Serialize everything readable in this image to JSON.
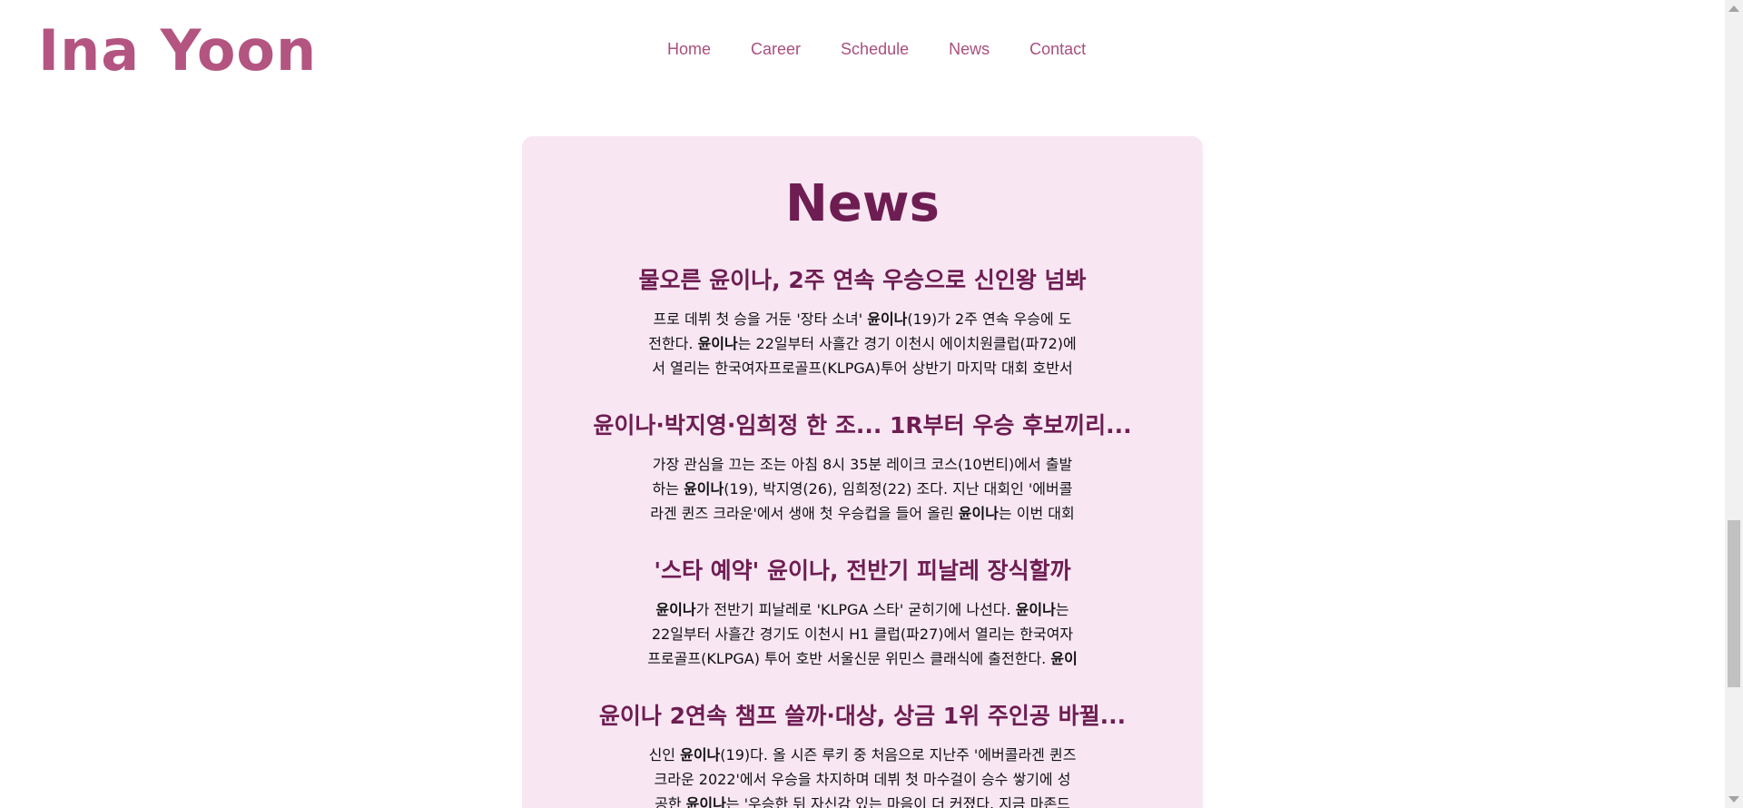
{
  "header": {
    "logo": "Ina Yoon",
    "nav": [
      "Home",
      "Career",
      "Schedule",
      "News",
      "Contact"
    ]
  },
  "news": {
    "title": "News",
    "articles": [
      {
        "title": "물오른 윤이나, 2주 연속 우승으로 신인왕 넘봐",
        "lines": [
          [
            "프로 데뷔 첫 승을 거둔 '장타 소녀' ",
            {
              "b": "윤이나"
            },
            "(19)가 2주 연속 우승에 도"
          ],
          [
            "전한다. ",
            {
              "b": "윤이나"
            },
            "는 22일부터 사흘간 경기 이천시 에이치원클럽(파72)에"
          ],
          [
            "서 열리는 한국여자프로골프(KLPGA)투어 상반기 마지막 대회 호반서"
          ]
        ]
      },
      {
        "title": "윤이나·박지영·임희정 한 조... 1R부터 우승 후보끼리...",
        "lines": [
          [
            "가장 관심을 끄는 조는 아침 8시 35분 레이크 코스(10번티)에서 출발"
          ],
          [
            "하는 ",
            {
              "b": "윤이나"
            },
            "(19), 박지영(26), 임희정(22) 조다. 지난 대회인 '에버콜"
          ],
          [
            "라겐 퀸즈 크라운'에서 생애 첫 우승컵을 들어 올린 ",
            {
              "b": "윤이나"
            },
            "는 이번 대회"
          ]
        ]
      },
      {
        "title": "'스타 예약' 윤이나, 전반기 피날레 장식할까",
        "lines": [
          [
            {
              "b": "윤이나"
            },
            "가 전반기 피날레로 'KLPGA 스타' 굳히기에 나선다. ",
            {
              "b": "윤이나"
            },
            "는"
          ],
          [
            "22일부터 사흘간 경기도 이천시 H1 클럽(파27)에서 열리는 한국여자"
          ],
          [
            "프로골프(KLPGA) 투어 호반 서울신문 위민스 클래식에 출전한다. ",
            {
              "b": "윤이"
            }
          ]
        ]
      },
      {
        "title": "윤이나 2연속 챔프 쓸까·대상, 상금 1위 주인공 바뀔...",
        "lines": [
          [
            "신인 ",
            {
              "b": "윤이나"
            },
            "(19)다. 올 시즌 루키 중 처음으로 지난주 '에버콜라겐 퀸즈"
          ],
          [
            "크라운 2022'에서 우승을 차지하며 데뷔 첫 마수걸이 승수 쌓기에 성"
          ],
          [
            "공한 ",
            {
              "b": "윤이나"
            },
            "는 '우승한 뒤 자신감 있는 마음이 더 커졌다. 지금 마존드"
          ]
        ]
      }
    ]
  }
}
